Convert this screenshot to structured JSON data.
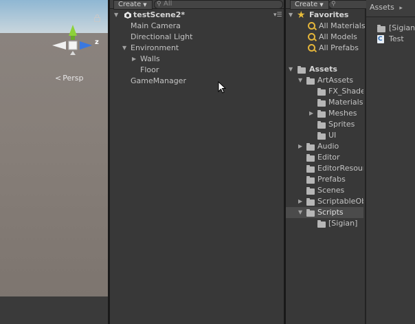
{
  "scene": {
    "persp_label": "Persp",
    "gizmo_axis_label": "z",
    "colors": {
      "x_axis": "#f0f0f0",
      "y_axis": "#8dd23a",
      "z_axis": "#3a78e0"
    }
  },
  "hierarchy": {
    "create_label": "Create",
    "search_placeholder": "All",
    "scene_name": "testScene2*",
    "items": [
      {
        "label": "Main Camera"
      },
      {
        "label": "Directional Light"
      },
      {
        "label": "Environment"
      },
      {
        "label": "Walls"
      },
      {
        "label": "Floor"
      },
      {
        "label": "GameManager"
      }
    ]
  },
  "project": {
    "create_label": "Create",
    "favorites": {
      "header": "Favorites",
      "items": [
        "All Materials",
        "All Models",
        "All Prefabs"
      ]
    },
    "assets": {
      "header": "Assets",
      "tree": [
        "ArtAssets",
        "FX_Shaders",
        "Materials",
        "Meshes",
        "Sprites",
        "UI",
        "Audio",
        "Editor",
        "EditorResources",
        "Prefabs",
        "Scenes",
        "ScriptableObjects",
        "Scripts",
        "[Sigian]"
      ]
    },
    "breadcrumb": {
      "root": "Assets",
      "separator": "▸"
    },
    "contents": [
      "[Sigian]",
      "Test"
    ]
  }
}
